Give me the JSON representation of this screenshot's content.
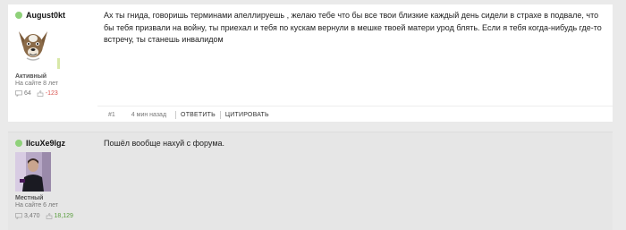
{
  "posts": [
    {
      "author": "August0kt",
      "rank": "Активный",
      "since": "На сайте 8 лет",
      "messages": "64",
      "reputation": "-123",
      "text": "Ах ты гнида, говоришь терминами апеллируешь , желаю тебе что бы все твои близкие каждый день сидели в страхе в подвале, что бы тебя призвали на войну, ты приехал и тебя по кускам вернули в мешке твоей матери урод блять. Если я тебя когда-нибудь где-то встречу,  ты станешь инвалидом",
      "number": "#1",
      "time": "4 мин назад",
      "reply_label": "ОТВЕТИТЬ",
      "quote_label": "ЦИТИРОВАТЬ"
    },
    {
      "author": "IIcuXe9lgz",
      "rank": "Местный",
      "since": "На сайте 6 лет",
      "messages": "3,470",
      "reputation": "18,129",
      "text": "Пошёл вообще нахуй с форума."
    }
  ],
  "colors": {
    "online": "#8fd17a",
    "negative": "#d9534f",
    "positive": "#5a9e3e"
  }
}
